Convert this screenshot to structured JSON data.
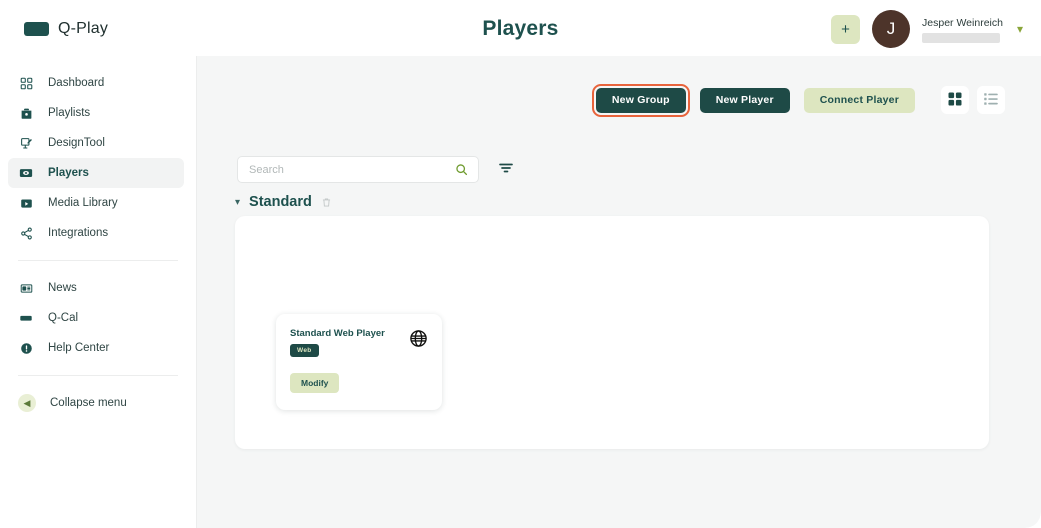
{
  "header": {
    "brand": "Q-Play",
    "brand_mark_icon": "logo-mark",
    "title": "Players",
    "add_label": "+",
    "user": {
      "initial": "J",
      "name": "Jesper Weinreich"
    },
    "caret_icon": "chevron-down-icon"
  },
  "sidebar": {
    "items": [
      {
        "label": "Dashboard",
        "icon": "dashboard-icon",
        "active": false
      },
      {
        "label": "Playlists",
        "icon": "playlists-icon",
        "active": false
      },
      {
        "label": "DesignTool",
        "icon": "design-tool-icon",
        "active": false
      },
      {
        "label": "Players",
        "icon": "players-icon",
        "active": true
      },
      {
        "label": "Media Library",
        "icon": "media-library-icon",
        "active": false
      },
      {
        "label": "Integrations",
        "icon": "integrations-icon",
        "active": false
      }
    ],
    "secondary": [
      {
        "label": "News",
        "icon": "news-icon"
      },
      {
        "label": "Q-Cal",
        "icon": "q-cal-icon"
      },
      {
        "label": "Help Center",
        "icon": "help-center-icon"
      }
    ],
    "collapse": {
      "label": "Collapse menu",
      "icon": "chevron-left-icon"
    }
  },
  "toolbar": {
    "new_group": "New Group",
    "new_player": "New Player",
    "connect_player": "Connect Player",
    "grid_view_icon": "grid-view-icon",
    "list_view_icon": "list-view-icon",
    "focused_button": "New Group"
  },
  "filters": {
    "search_placeholder": "Search",
    "search_value": "",
    "search_icon": "search-icon",
    "filter_icon": "filter-icon"
  },
  "group": {
    "name": "Standard",
    "chevron_icon": "chevron-down-icon",
    "delete_icon": "trash-icon",
    "expanded": true
  },
  "player": {
    "name": "Standard Web Player",
    "badge": "Web",
    "type_icon": "globe-icon",
    "modify_label": "Modify"
  },
  "colors": {
    "brand_dark": "#1e514e",
    "button_dark": "#1e4a46",
    "button_light": "#dde6c0",
    "focus_ring": "#e8643c",
    "avatar": "#4d342a",
    "canvas": "#f5f6f6",
    "search_icon": "#6f9b2e"
  }
}
